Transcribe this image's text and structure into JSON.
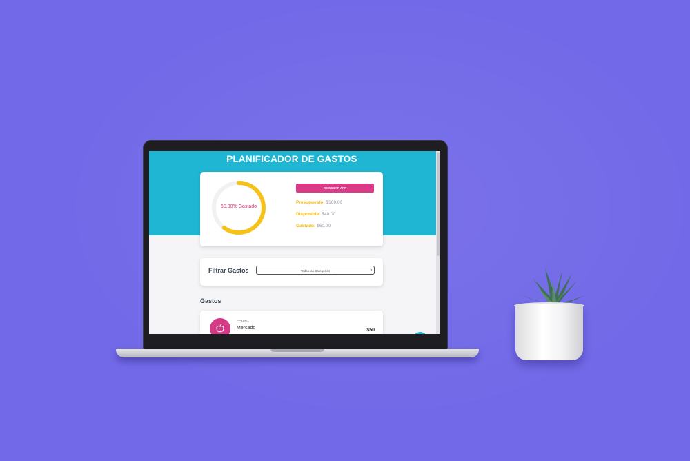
{
  "colors": {
    "background": "#7269e8",
    "header": "#1fb6d3",
    "accent_pink": "#db3a86",
    "accent_yellow": "#f6b800"
  },
  "app": {
    "title": "PLANIFICADOR DE GASTOS"
  },
  "budget": {
    "progress_percent": 60,
    "progress_label": "60.00% Gastado",
    "reset_button_label": "REINICIAR APP",
    "stats": [
      {
        "label": "Presupuesto:",
        "value": "$100.00"
      },
      {
        "label": "Disponible:",
        "value": "$40.00"
      },
      {
        "label": "Gastado:",
        "value": "$60.00"
      }
    ]
  },
  "filter": {
    "label": "Filtrar Gastos",
    "selected_option": "-- Todas las Categorías --"
  },
  "expenses": {
    "section_title": "Gastos",
    "items": [
      {
        "category": "COMIDA",
        "name": "Mercado",
        "amount": "$50",
        "icon": "apple-icon"
      }
    ]
  },
  "icons": {
    "new_expense_button": "plus-icon"
  }
}
